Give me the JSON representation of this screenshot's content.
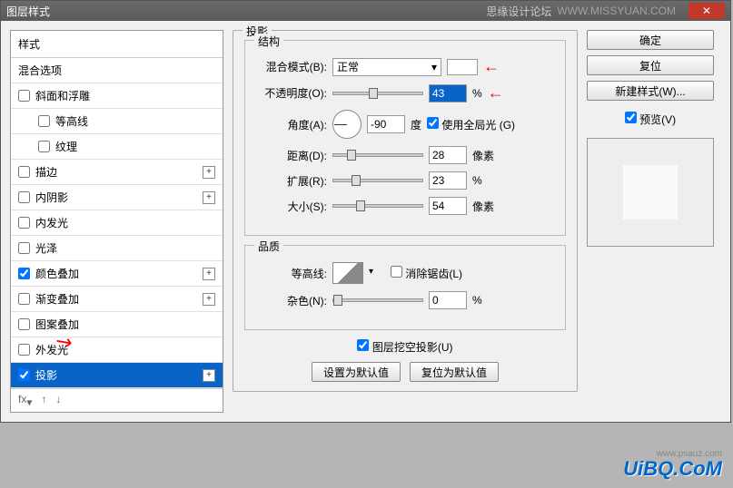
{
  "title": "图层样式",
  "titlebar_right": "思缘设计论坛",
  "titlebar_url": "WWW.MISSYUAN.COM",
  "left": {
    "header": "样式",
    "blending": "混合选项",
    "items": [
      {
        "label": "斜面和浮雕",
        "checked": false,
        "plus": false
      },
      {
        "label": "等高线",
        "checked": false,
        "plus": false,
        "sub": true
      },
      {
        "label": "纹理",
        "checked": false,
        "plus": false,
        "sub": true
      },
      {
        "label": "描边",
        "checked": false,
        "plus": true
      },
      {
        "label": "内阴影",
        "checked": false,
        "plus": true
      },
      {
        "label": "内发光",
        "checked": false,
        "plus": false
      },
      {
        "label": "光泽",
        "checked": false,
        "plus": false
      },
      {
        "label": "颜色叠加",
        "checked": true,
        "plus": true
      },
      {
        "label": "渐变叠加",
        "checked": false,
        "plus": true
      },
      {
        "label": "图案叠加",
        "checked": false,
        "plus": false
      },
      {
        "label": "外发光",
        "checked": false,
        "plus": false
      },
      {
        "label": "投影",
        "checked": true,
        "plus": true,
        "selected": true
      }
    ],
    "footer_fx": "fx"
  },
  "mid": {
    "section_title": "投影",
    "struct_title": "结构",
    "blend_mode_label": "混合模式(B):",
    "blend_mode_value": "正常",
    "opacity_label": "不透明度(O):",
    "opacity_value": "43",
    "opacity_unit": "%",
    "angle_label": "角度(A):",
    "angle_value": "-90",
    "angle_unit": "度",
    "global_light": "使用全局光 (G)",
    "distance_label": "距离(D):",
    "distance_value": "28",
    "distance_unit": "像素",
    "spread_label": "扩展(R):",
    "spread_value": "23",
    "spread_unit": "%",
    "size_label": "大小(S):",
    "size_value": "54",
    "size_unit": "像素",
    "quality_title": "品质",
    "contour_label": "等高线:",
    "antialias": "消除锯齿(L)",
    "noise_label": "杂色(N):",
    "noise_value": "0",
    "noise_unit": "%",
    "knockout": "图层挖空投影(U)",
    "btn_default": "设置为默认值",
    "btn_reset": "复位为默认值"
  },
  "right": {
    "ok": "确定",
    "cancel": "复位",
    "new_style": "新建样式(W)...",
    "preview": "预览(V)"
  },
  "watermark": "UiBQ.CoM",
  "watermark2": "www.psauz.com"
}
